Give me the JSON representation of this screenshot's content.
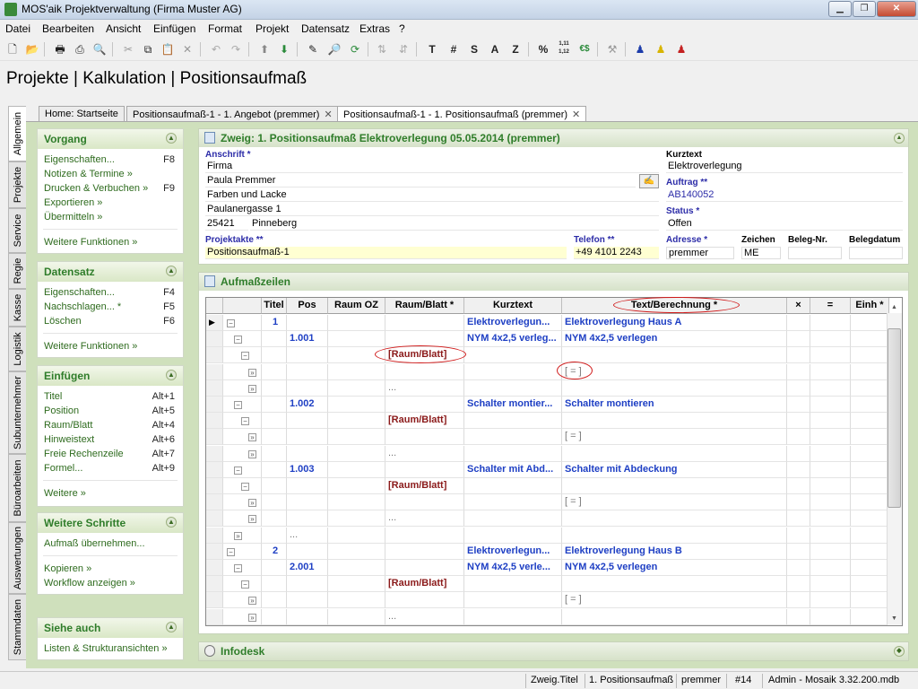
{
  "window": {
    "title": "MOS'aik Projektverwaltung (Firma Muster AG)"
  },
  "menu": [
    "Datei",
    "Bearbeiten",
    "Ansicht",
    "Einfügen",
    "Format",
    "Projekt",
    "Datensatz",
    "Extras",
    "?"
  ],
  "toolbar": {
    "text_buttons": [
      "T",
      "#",
      "S",
      "A",
      "Z",
      "%",
      "€$"
    ],
    "number_button": "1,11\n1,12"
  },
  "heading": "Projekte | Kalkulation | Positionsaufmaß",
  "side_tabs": [
    "Allgemein",
    "Projekte",
    "Service",
    "Regie",
    "Kasse",
    "Logistik",
    "Subunternehmer",
    "Büroarbeiten",
    "Auswertungen",
    "Stammdaten"
  ],
  "doc_tabs": [
    "Home: Startseite",
    "Positionsaufmaß-1 - 1. Angebot (premmer)",
    "Positionsaufmaß-1 - 1. Positionsaufmaß (premmer)"
  ],
  "sidebar": {
    "vorgang": {
      "title": "Vorgang",
      "items": [
        {
          "label": "Eigenschaften...",
          "shortcut": "F8"
        },
        {
          "label": "Notizen & Termine »",
          "shortcut": ""
        },
        {
          "label": "Drucken & Verbuchen »",
          "shortcut": "F9"
        },
        {
          "label": "Exportieren »",
          "shortcut": ""
        },
        {
          "label": "Übermitteln »",
          "shortcut": ""
        }
      ],
      "more": "Weitere Funktionen »"
    },
    "datensatz": {
      "title": "Datensatz",
      "items": [
        {
          "label": "Eigenschaften...",
          "shortcut": "F4"
        },
        {
          "label": "Nachschlagen... *",
          "shortcut": "F5"
        },
        {
          "label": "Löschen",
          "shortcut": "F6"
        }
      ],
      "more": "Weitere Funktionen »"
    },
    "einfuegen": {
      "title": "Einfügen",
      "items": [
        {
          "label": "Titel",
          "shortcut": "Alt+1"
        },
        {
          "label": "Position",
          "shortcut": "Alt+5"
        },
        {
          "label": "Raum/Blatt",
          "shortcut": "Alt+4"
        },
        {
          "label": "Hinweistext",
          "shortcut": "Alt+6"
        },
        {
          "label": "Freie Rechenzeile",
          "shortcut": "Alt+7"
        },
        {
          "label": "Formel...",
          "shortcut": "Alt+9"
        }
      ],
      "more": "Weitere »"
    },
    "weitere": {
      "title": "Weitere Schritte",
      "items": [
        "Aufmaß übernehmen...",
        "Kopieren »",
        "Workflow anzeigen »"
      ]
    },
    "siehe": {
      "title": "Siehe auch",
      "items": [
        "Listen & Strukturansichten »"
      ]
    }
  },
  "zweig": {
    "title": "Zweig: 1. Positionsaufmaß Elektroverlegung 05.05.2014 (premmer)",
    "anschrift_label": "Anschrift *",
    "anschrift": [
      "Firma",
      "Paula Premmer",
      "Farben und Lacke",
      "Paulanergasse 1"
    ],
    "plz": "25421",
    "ort": "Pinneberg",
    "kurztext_label": "Kurztext",
    "kurztext": "Elektroverlegung",
    "auftrag_label": "Auftrag **",
    "auftrag": "AB140052",
    "status_label": "Status *",
    "status": "Offen",
    "projektakte_label": "Projektakte **",
    "projektakte": "Positionsaufmaß-1",
    "telefon_label": "Telefon **",
    "telefon": "+49 4101 2243",
    "adresse_label": "Adresse *",
    "adresse": "premmer",
    "zeichen_label": "Zeichen",
    "zeichen": "ME",
    "belegnr_label": "Beleg-Nr.",
    "belegdatum_label": "Belegdatum"
  },
  "aufmass": {
    "title": "Aufmaßzeilen",
    "columns": [
      "Titel",
      "Pos",
      "Raum OZ",
      "Raum/Blatt *",
      "Kurztext",
      "Text/Berechnung *",
      "×",
      "=",
      "Einh *"
    ],
    "rows": [
      {
        "titel": "1",
        "pos": "",
        "raumblatt": "",
        "kurz": "Elektroverlegun...",
        "text": "Elektroverlegung Haus A",
        "kind": "title"
      },
      {
        "titel": "",
        "pos": "1.001",
        "raumblatt": "",
        "kurz": "NYM 4x2,5 verleg...",
        "text": "NYM 4x2,5 verlegen",
        "kind": "pos"
      },
      {
        "titel": "",
        "pos": "",
        "raumblatt": "[Raum/Blatt]",
        "kurz": "",
        "text": "",
        "kind": "raum"
      },
      {
        "titel": "",
        "pos": "",
        "raumblatt": "",
        "kurz": "",
        "text": "[ = ]",
        "kind": "calc"
      },
      {
        "titel": "",
        "pos": "",
        "raumblatt": "...",
        "kurz": "",
        "text": "",
        "kind": "dots"
      },
      {
        "titel": "",
        "pos": "1.002",
        "raumblatt": "",
        "kurz": "Schalter montier...",
        "text": "Schalter montieren",
        "kind": "pos"
      },
      {
        "titel": "",
        "pos": "",
        "raumblatt": "[Raum/Blatt]",
        "kurz": "",
        "text": "",
        "kind": "raum"
      },
      {
        "titel": "",
        "pos": "",
        "raumblatt": "",
        "kurz": "",
        "text": "[ = ]",
        "kind": "calc"
      },
      {
        "titel": "",
        "pos": "",
        "raumblatt": "...",
        "kurz": "",
        "text": "",
        "kind": "dots"
      },
      {
        "titel": "",
        "pos": "1.003",
        "raumblatt": "",
        "kurz": "Schalter mit Abd...",
        "text": "Schalter mit Abdeckung",
        "kind": "pos"
      },
      {
        "titel": "",
        "pos": "",
        "raumblatt": "[Raum/Blatt]",
        "kurz": "",
        "text": "",
        "kind": "raum"
      },
      {
        "titel": "",
        "pos": "",
        "raumblatt": "",
        "kurz": "",
        "text": "[ = ]",
        "kind": "calc"
      },
      {
        "titel": "",
        "pos": "",
        "raumblatt": "...",
        "kurz": "",
        "text": "",
        "kind": "dots"
      },
      {
        "titel": "",
        "pos": "...",
        "raumblatt": "",
        "kurz": "",
        "text": "",
        "kind": "dots2"
      },
      {
        "titel": "2",
        "pos": "",
        "raumblatt": "",
        "kurz": "Elektroverlegun...",
        "text": "Elektroverlegung Haus B",
        "kind": "title"
      },
      {
        "titel": "",
        "pos": "2.001",
        "raumblatt": "",
        "kurz": "NYM 4x2,5 verle...",
        "text": "NYM 4x2,5 verlegen",
        "kind": "pos"
      },
      {
        "titel": "",
        "pos": "",
        "raumblatt": "[Raum/Blatt]",
        "kurz": "",
        "text": "",
        "kind": "raum"
      },
      {
        "titel": "",
        "pos": "",
        "raumblatt": "",
        "kurz": "",
        "text": "[ = ]",
        "kind": "calc"
      },
      {
        "titel": "",
        "pos": "",
        "raumblatt": "...",
        "kurz": "",
        "text": "",
        "kind": "dots"
      }
    ]
  },
  "infodesk": {
    "title": "Infodesk"
  },
  "statusbar": [
    "Zweig.Titel",
    "1. Positionsaufmaß",
    "premmer",
    "#14",
    "Admin - Mosaik 3.32.200.mdb"
  ],
  "colors": {
    "green_header": "#2f7d2a",
    "link_green": "#2e6b1e",
    "blue_text": "#1e3fc4",
    "red_text": "#8b1a1a",
    "main_bg": "#cfe0bc"
  }
}
